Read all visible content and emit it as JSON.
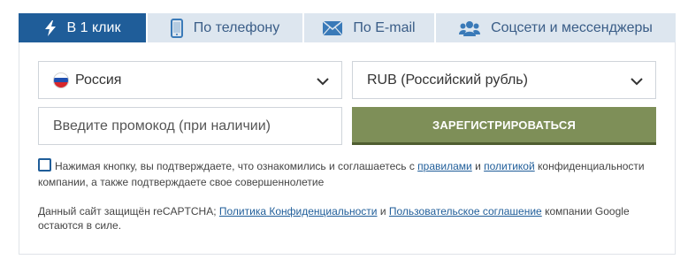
{
  "tabs": [
    {
      "label": "В 1 клик",
      "icon": "lightning-icon",
      "active": true
    },
    {
      "label": "По телефону",
      "icon": "phone-icon",
      "active": false
    },
    {
      "label": "По E-mail",
      "icon": "envelope-icon",
      "active": false
    },
    {
      "label": "Соцсети и мессенджеры",
      "icon": "users-icon",
      "active": false
    }
  ],
  "form": {
    "country_value": "Россия",
    "currency_value": "RUB (Российский рубль)",
    "promo_placeholder": "Введите промокод (при наличии)",
    "register_label": "ЗАРЕГИСТРИРОВАТЬСЯ"
  },
  "consent": {
    "checked": false,
    "text_1": "Нажимая кнопку, вы подтверждаете, что ознакомились и соглашаетесь с ",
    "link_rules": "правилами",
    "text_2": " и ",
    "link_policy": "политикой",
    "text_3": " конфиденциальности компании, а также подтверждаете свое совершеннолетие"
  },
  "recaptcha": {
    "text_1": "Данный сайт защищён reCAPTCHA; ",
    "link_privacy": "Политика Конфиденциальности",
    "text_2": " и ",
    "link_terms": "Пользовательское соглашение",
    "text_3": " компании Google остаются в силе."
  },
  "colors": {
    "accent": "#1f5d99",
    "tab_inactive_bg": "#dde6ef",
    "button_bg": "#7e8f58"
  }
}
